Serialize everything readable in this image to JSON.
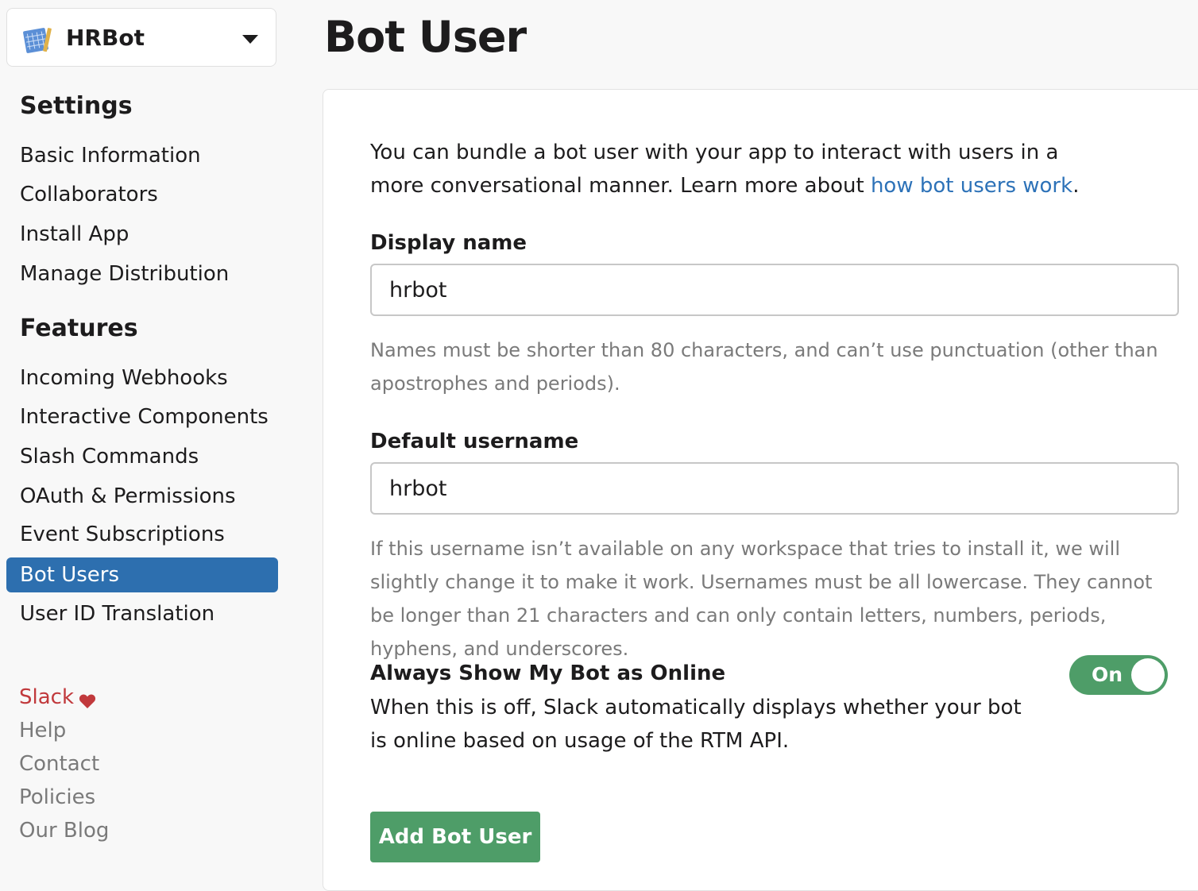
{
  "app_switcher": {
    "app_name": "HRBot",
    "icon": "app-blueprint-icon",
    "dropdown_icon": "chevron-down-icon"
  },
  "sidebar": {
    "settings_heading": "Settings",
    "settings_items": [
      {
        "label": "Basic Information"
      },
      {
        "label": "Collaborators"
      },
      {
        "label": "Install App"
      },
      {
        "label": "Manage Distribution"
      }
    ],
    "features_heading": "Features",
    "features_items": [
      {
        "label": "Incoming Webhooks"
      },
      {
        "label": "Interactive Components"
      },
      {
        "label": "Slash Commands"
      },
      {
        "label": "OAuth & Permissions"
      },
      {
        "label": "Event Subscriptions"
      },
      {
        "label": "Bot Users",
        "active": true
      },
      {
        "label": "User ID Translation"
      }
    ],
    "footer": {
      "slack": "Slack",
      "slack_icon": "heart-icon",
      "help": "Help",
      "contact": "Contact",
      "policies": "Policies",
      "blog": "Our Blog"
    }
  },
  "main": {
    "title": "Bot User",
    "intro_text": "You can bundle a bot user with your app to interact with users in a more conversational manner. Learn more about ",
    "intro_link": "how bot users work",
    "intro_end": ".",
    "display_name": {
      "label": "Display name",
      "value": "hrbot",
      "help": "Names must be shorter than 80 characters, and can’t use punctuation (other than apostrophes and periods)."
    },
    "default_username": {
      "label": "Default username",
      "value": "hrbot",
      "help": "If this username isn’t available on any workspace that tries to install it, we will slightly change it to make it work. Usernames must be all lowercase. They cannot be longer than 21 characters and can only contain letters, numbers, periods, hyphens, and underscores."
    },
    "online_toggle": {
      "title": "Always Show My Bot as Online",
      "description": "When this is off, Slack automatically displays whether your bot is online based on usage of the RTM API.",
      "state_label": "On"
    },
    "add_button": "Add Bot User"
  },
  "colors": {
    "active_nav": "#2d6faf",
    "link": "#2d72b8",
    "success": "#4e9d68",
    "slack_red": "#c1393c"
  }
}
